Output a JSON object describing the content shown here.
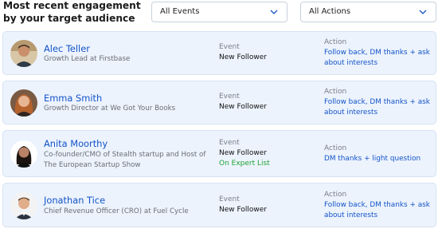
{
  "header": {
    "title": "Most recent engagement by your target audience",
    "events_filter": "All Events",
    "actions_filter": "All Actions"
  },
  "labels": {
    "event": "Event",
    "action": "Action"
  },
  "rows": [
    {
      "name": "Alec Teller",
      "role": "Growth Lead at Firstbase",
      "event": "New Follower",
      "event_extra": "",
      "action": "Follow back, DM thanks + ask about interests"
    },
    {
      "name": "Emma Smith",
      "role": "Growth Director at We Got Your Books",
      "event": "New Follower",
      "event_extra": "",
      "action": "Follow back, DM thanks + ask about interests"
    },
    {
      "name": "Anita Moorthy",
      "role": "Co-founder/CMO of Stealth startup and Host of The European Startup Show",
      "event": "New Follower",
      "event_extra": "On Expert List",
      "action": "DM thanks + light question"
    },
    {
      "name": "Jonathan Tice",
      "role": "Chief Revenue Officer (CRO) at Fuel Cycle",
      "event": "New Follower",
      "event_extra": "",
      "action": "Follow back, DM thanks + ask about interests"
    }
  ],
  "colors": {
    "card_bg": "#ecf3fd",
    "link_blue": "#1453c8",
    "green": "#21a334"
  }
}
